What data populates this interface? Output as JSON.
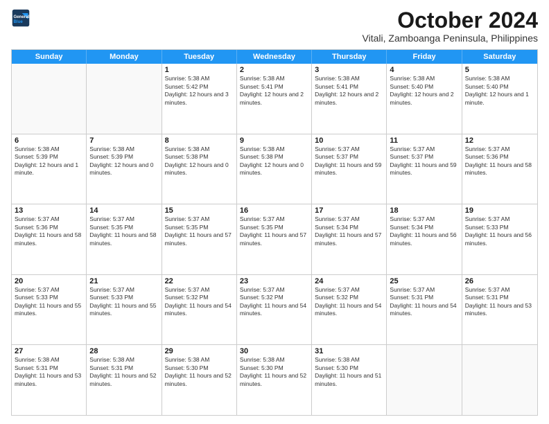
{
  "header": {
    "logo_line1": "General",
    "logo_line2": "Blue",
    "month_title": "October 2024",
    "subtitle": "Vitali, Zamboanga Peninsula, Philippines"
  },
  "calendar": {
    "weekdays": [
      "Sunday",
      "Monday",
      "Tuesday",
      "Wednesday",
      "Thursday",
      "Friday",
      "Saturday"
    ],
    "rows": [
      [
        {
          "day": "",
          "empty": true
        },
        {
          "day": "",
          "empty": true
        },
        {
          "day": "1",
          "sunrise": "5:38 AM",
          "sunset": "5:42 PM",
          "daylight": "12 hours and 3 minutes."
        },
        {
          "day": "2",
          "sunrise": "5:38 AM",
          "sunset": "5:41 PM",
          "daylight": "12 hours and 2 minutes."
        },
        {
          "day": "3",
          "sunrise": "5:38 AM",
          "sunset": "5:41 PM",
          "daylight": "12 hours and 2 minutes."
        },
        {
          "day": "4",
          "sunrise": "5:38 AM",
          "sunset": "5:40 PM",
          "daylight": "12 hours and 2 minutes."
        },
        {
          "day": "5",
          "sunrise": "5:38 AM",
          "sunset": "5:40 PM",
          "daylight": "12 hours and 1 minute."
        }
      ],
      [
        {
          "day": "6",
          "sunrise": "5:38 AM",
          "sunset": "5:39 PM",
          "daylight": "12 hours and 1 minute."
        },
        {
          "day": "7",
          "sunrise": "5:38 AM",
          "sunset": "5:39 PM",
          "daylight": "12 hours and 0 minutes."
        },
        {
          "day": "8",
          "sunrise": "5:38 AM",
          "sunset": "5:38 PM",
          "daylight": "12 hours and 0 minutes."
        },
        {
          "day": "9",
          "sunrise": "5:38 AM",
          "sunset": "5:38 PM",
          "daylight": "12 hours and 0 minutes."
        },
        {
          "day": "10",
          "sunrise": "5:37 AM",
          "sunset": "5:37 PM",
          "daylight": "11 hours and 59 minutes."
        },
        {
          "day": "11",
          "sunrise": "5:37 AM",
          "sunset": "5:37 PM",
          "daylight": "11 hours and 59 minutes."
        },
        {
          "day": "12",
          "sunrise": "5:37 AM",
          "sunset": "5:36 PM",
          "daylight": "11 hours and 58 minutes."
        }
      ],
      [
        {
          "day": "13",
          "sunrise": "5:37 AM",
          "sunset": "5:36 PM",
          "daylight": "11 hours and 58 minutes."
        },
        {
          "day": "14",
          "sunrise": "5:37 AM",
          "sunset": "5:35 PM",
          "daylight": "11 hours and 58 minutes."
        },
        {
          "day": "15",
          "sunrise": "5:37 AM",
          "sunset": "5:35 PM",
          "daylight": "11 hours and 57 minutes."
        },
        {
          "day": "16",
          "sunrise": "5:37 AM",
          "sunset": "5:35 PM",
          "daylight": "11 hours and 57 minutes."
        },
        {
          "day": "17",
          "sunrise": "5:37 AM",
          "sunset": "5:34 PM",
          "daylight": "11 hours and 57 minutes."
        },
        {
          "day": "18",
          "sunrise": "5:37 AM",
          "sunset": "5:34 PM",
          "daylight": "11 hours and 56 minutes."
        },
        {
          "day": "19",
          "sunrise": "5:37 AM",
          "sunset": "5:33 PM",
          "daylight": "11 hours and 56 minutes."
        }
      ],
      [
        {
          "day": "20",
          "sunrise": "5:37 AM",
          "sunset": "5:33 PM",
          "daylight": "11 hours and 55 minutes."
        },
        {
          "day": "21",
          "sunrise": "5:37 AM",
          "sunset": "5:33 PM",
          "daylight": "11 hours and 55 minutes."
        },
        {
          "day": "22",
          "sunrise": "5:37 AM",
          "sunset": "5:32 PM",
          "daylight": "11 hours and 54 minutes."
        },
        {
          "day": "23",
          "sunrise": "5:37 AM",
          "sunset": "5:32 PM",
          "daylight": "11 hours and 54 minutes."
        },
        {
          "day": "24",
          "sunrise": "5:37 AM",
          "sunset": "5:32 PM",
          "daylight": "11 hours and 54 minutes."
        },
        {
          "day": "25",
          "sunrise": "5:37 AM",
          "sunset": "5:31 PM",
          "daylight": "11 hours and 54 minutes."
        },
        {
          "day": "26",
          "sunrise": "5:37 AM",
          "sunset": "5:31 PM",
          "daylight": "11 hours and 53 minutes."
        }
      ],
      [
        {
          "day": "27",
          "sunrise": "5:38 AM",
          "sunset": "5:31 PM",
          "daylight": "11 hours and 53 minutes."
        },
        {
          "day": "28",
          "sunrise": "5:38 AM",
          "sunset": "5:31 PM",
          "daylight": "11 hours and 52 minutes."
        },
        {
          "day": "29",
          "sunrise": "5:38 AM",
          "sunset": "5:30 PM",
          "daylight": "11 hours and 52 minutes."
        },
        {
          "day": "30",
          "sunrise": "5:38 AM",
          "sunset": "5:30 PM",
          "daylight": "11 hours and 52 minutes."
        },
        {
          "day": "31",
          "sunrise": "5:38 AM",
          "sunset": "5:30 PM",
          "daylight": "11 hours and 51 minutes."
        },
        {
          "day": "",
          "empty": true
        },
        {
          "day": "",
          "empty": true
        }
      ]
    ]
  }
}
